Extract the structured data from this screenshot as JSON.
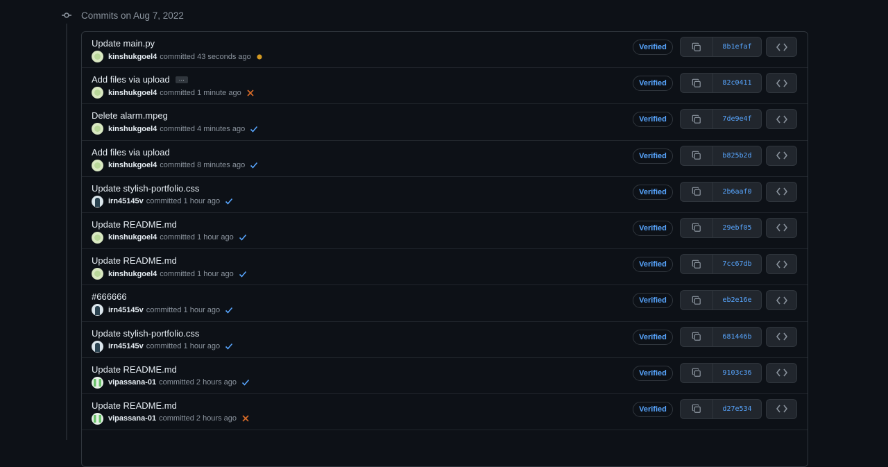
{
  "timeline": {
    "title": "Commits on Aug 7, 2022"
  },
  "colors": {
    "accent": "#58a6ff",
    "pending": "#d29922",
    "failure": "#db6d28",
    "success": "#58a6ff"
  },
  "commits": [
    {
      "title": "Update main.py",
      "author": "kinshukgoel4",
      "committed": "committed 43 seconds ago",
      "status": "pending-dot-icon",
      "avatar": "a1",
      "verified": "Verified",
      "sha": "8b1efaf",
      "has_ellipsis": false
    },
    {
      "title": "Add files via upload",
      "author": "kinshukgoel4",
      "committed": "committed 1 minute ago",
      "status": "x-icon",
      "avatar": "a1",
      "verified": "Verified",
      "sha": "82c0411",
      "has_ellipsis": true,
      "ellipsis": "…"
    },
    {
      "title": "Delete alarm.mpeg",
      "author": "kinshukgoel4",
      "committed": "committed 4 minutes ago",
      "status": "check-icon",
      "avatar": "a1",
      "verified": "Verified",
      "sha": "7de9e4f",
      "has_ellipsis": false
    },
    {
      "title": "Add files via upload",
      "author": "kinshukgoel4",
      "committed": "committed 8 minutes ago",
      "status": "check-icon",
      "avatar": "a1",
      "verified": "Verified",
      "sha": "b825b2d",
      "has_ellipsis": false
    },
    {
      "title": "Update stylish-portfolio.css",
      "author": "irn45145v",
      "committed": "committed 1 hour ago",
      "status": "check-icon",
      "avatar": "a2",
      "verified": "Verified",
      "sha": "2b6aaf0",
      "has_ellipsis": false
    },
    {
      "title": "Update README.md",
      "author": "kinshukgoel4",
      "committed": "committed 1 hour ago",
      "status": "check-icon",
      "avatar": "a1",
      "verified": "Verified",
      "sha": "29ebf05",
      "has_ellipsis": false
    },
    {
      "title": "Update README.md",
      "author": "kinshukgoel4",
      "committed": "committed 1 hour ago",
      "status": "check-icon",
      "avatar": "a1",
      "verified": "Verified",
      "sha": "7cc67db",
      "has_ellipsis": false
    },
    {
      "title": "#666666",
      "author": "irn45145v",
      "committed": "committed 1 hour ago",
      "status": "check-icon",
      "avatar": "a2",
      "verified": "Verified",
      "sha": "eb2e16e",
      "has_ellipsis": false
    },
    {
      "title": "Update stylish-portfolio.css",
      "author": "irn45145v",
      "committed": "committed 1 hour ago",
      "status": "check-icon",
      "avatar": "a2",
      "verified": "Verified",
      "sha": "681446b",
      "has_ellipsis": false
    },
    {
      "title": "Update README.md",
      "author": "vipassana-01",
      "committed": "committed 2 hours ago",
      "status": "check-icon",
      "avatar": "a3",
      "verified": "Verified",
      "sha": "9103c36",
      "has_ellipsis": false
    },
    {
      "title": "Update README.md",
      "author": "vipassana-01",
      "committed": "committed 2 hours ago",
      "status": "x-icon",
      "avatar": "a3",
      "verified": "Verified",
      "sha": "d27e534",
      "has_ellipsis": false
    },
    {
      "title": "",
      "author": "",
      "committed": "",
      "status": "",
      "avatar": "a1",
      "verified": "",
      "sha": "",
      "has_ellipsis": false
    }
  ]
}
